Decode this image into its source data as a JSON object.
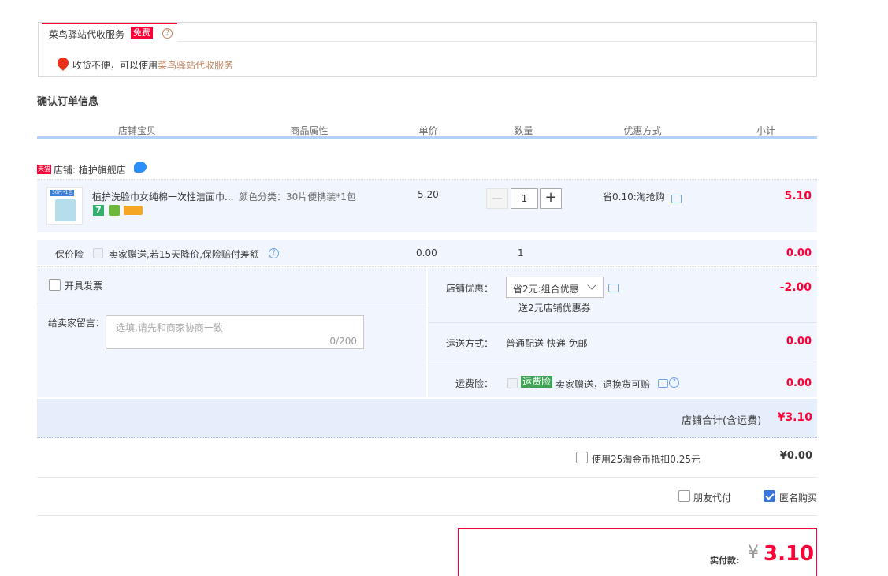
{
  "station": {
    "tab_label": "菜鸟驿站代收服务",
    "free_badge": "免费",
    "notice_prefix": "收货不便，可以使用",
    "notice_link": "菜鸟驿站代收服务"
  },
  "section_title": "确认订单信息",
  "table_headers": [
    "店铺宝贝",
    "商品属性",
    "单价",
    "数量",
    "优惠方式",
    "小计"
  ],
  "shop": {
    "badge": "天猫",
    "label": "店铺: 植护旗舰店"
  },
  "item": {
    "thumb_text": "30片*1包",
    "title": "植护洗脸巾女纯棉一次性洁面巾...",
    "attrs": "颜色分类：30片便携装*1包",
    "price": "5.20",
    "qty": "1",
    "promo": "省0.10:淘抢购",
    "subtotal": "5.10"
  },
  "insurance": {
    "label": "保价险",
    "desc": "卖家赠送,若15天降价,保险赔付差额",
    "price": "0.00",
    "qty": "1",
    "subtotal": "0.00"
  },
  "invoice": {
    "label": "开具发票"
  },
  "message": {
    "label": "给卖家留言：",
    "placeholder": "选填,请先和商家协商一致",
    "counter": "0/200"
  },
  "shop_discount": {
    "label": "店铺优惠：",
    "selected": "省2元:组合优惠",
    "note": "送2元店铺优惠券",
    "amount": "-2.00"
  },
  "shipping": {
    "label": "运送方式：",
    "value": "普通配送 快递 免邮",
    "amount": "0.00"
  },
  "freight_ins": {
    "label": "运费险：",
    "tag": "运费险",
    "desc": "卖家赠送，退换货可赔",
    "amount": "0.00"
  },
  "shop_total": {
    "label": "店铺合计(含运费)",
    "amount": "¥3.10"
  },
  "coins": {
    "label": "使用25淘金币抵扣0.25元",
    "amount": "¥0.00"
  },
  "options": {
    "friend_pay": "朋友代付",
    "anonymous": "匿名购买"
  },
  "pay": {
    "label": "实付款:",
    "currency": "¥",
    "amount": "3.10"
  },
  "colors": {
    "accent_red": "#ff0036",
    "light_blue": "#f0f5fe",
    "header_blue": "#b2d1ff",
    "link_orange": "#c28764"
  }
}
